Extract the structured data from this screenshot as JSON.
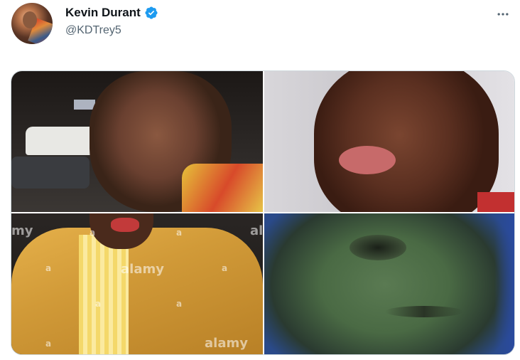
{
  "author": {
    "display_name": "Kevin Durant",
    "handle": "@KDTrey5",
    "verified": true
  },
  "actions": {
    "more_icon": "more-horizontal-icon"
  },
  "media": {
    "count": 4,
    "watermark": "alamy",
    "watermarks": {
      "img3_left_top": "my",
      "img3_center": "alamy",
      "img3_bottom": "alamy",
      "img3_right_top": "al",
      "img3_a1": "a",
      "img3_a2": "a",
      "img3_a3": "a",
      "img3_a4": "a",
      "img3_a5": "a",
      "img3_a6": "a",
      "img3_a7": "a"
    }
  },
  "colors": {
    "verified_badge": "#1d9bf0",
    "secondary_text": "#536471",
    "border": "#cfd9de"
  }
}
